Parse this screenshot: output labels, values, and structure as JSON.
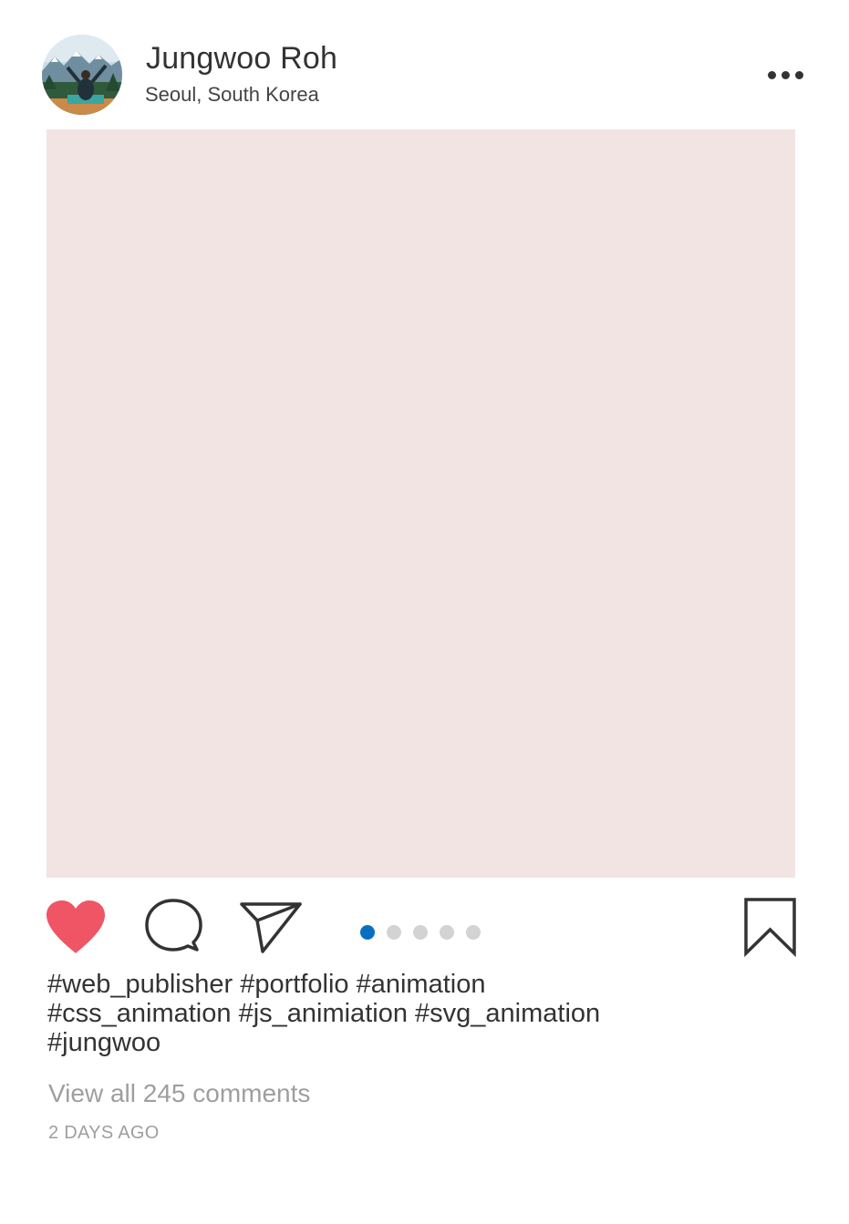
{
  "header": {
    "username": "Jungwoo Roh",
    "location": "Seoul, South Korea",
    "more_icon": "ellipsis-horizontal-icon"
  },
  "post": {
    "image_color": "#f2e4e3"
  },
  "actions": {
    "like_icon": "heart-filled-icon",
    "like_color": "#f05565",
    "comment_icon": "comment-bubble-icon",
    "share_icon": "paper-plane-icon",
    "bookmark_icon": "bookmark-icon",
    "icon_color": "#333333"
  },
  "pager": {
    "total": 5,
    "active_index": 0,
    "active_color": "#0a6fc2",
    "inactive_color": "#d3d3d3"
  },
  "caption": {
    "tags": [
      "#web_publisher",
      "#portfolio",
      "#animation",
      "#css_animation",
      "#js_animiation",
      "#svg_animation",
      "#jungwoo"
    ]
  },
  "comments": {
    "view_all_label": "View all 245 comments"
  },
  "timestamp": "2 DAYS AGO"
}
